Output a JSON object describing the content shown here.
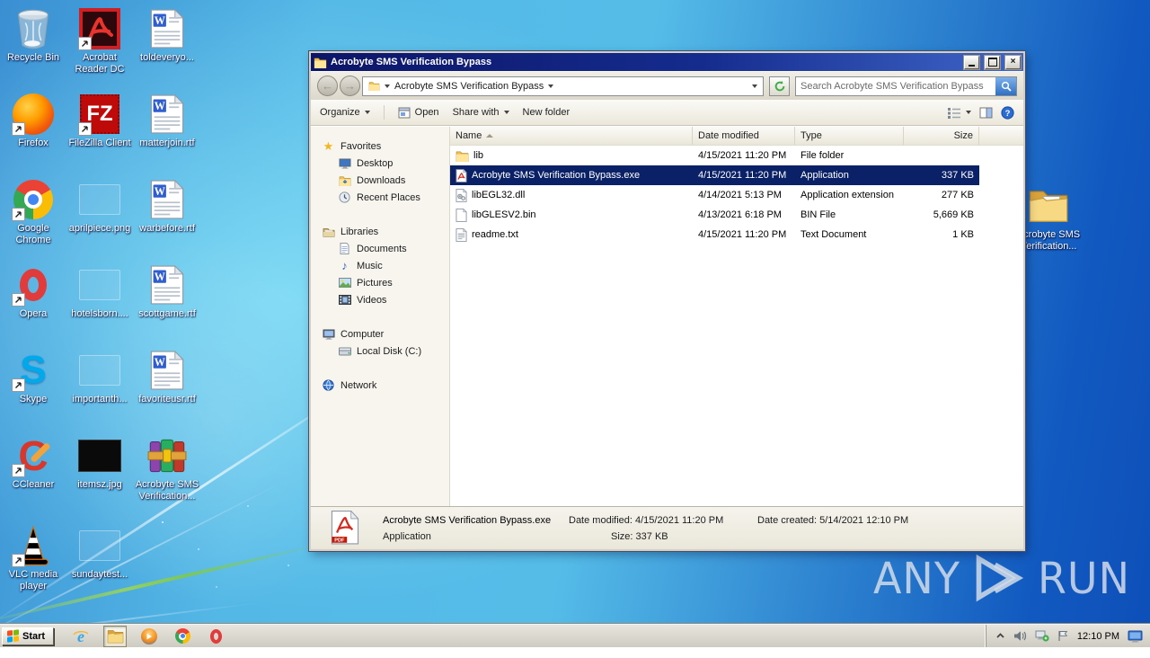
{
  "desktop": {
    "icons": [
      {
        "label": "Recycle Bin",
        "icon": "recycle-bin-icon"
      },
      {
        "label": "Acrobat Reader DC",
        "icon": "acrobat-reader-icon"
      },
      {
        "label": "toldeveryo...",
        "icon": "word-document-icon"
      },
      {
        "label": "Firefox",
        "icon": "firefox-icon"
      },
      {
        "label": "FileZilla Client",
        "icon": "filezilla-icon"
      },
      {
        "label": "matterjoin.rtf",
        "icon": "word-document-icon"
      },
      {
        "label": "Google Chrome",
        "icon": "chrome-icon"
      },
      {
        "label": "aprilpiece.png",
        "icon": "broken-image-icon"
      },
      {
        "label": "warbefore.rtf",
        "icon": "word-document-icon"
      },
      {
        "label": "Opera",
        "icon": "opera-icon"
      },
      {
        "label": "hotelsborn....",
        "icon": "broken-image-icon"
      },
      {
        "label": "scottgame.rtf",
        "icon": "word-document-icon"
      },
      {
        "label": "Skype",
        "icon": "skype-icon"
      },
      {
        "label": "importanth...",
        "icon": "broken-image-icon"
      },
      {
        "label": "favoriteusr.rtf",
        "icon": "word-document-icon"
      },
      {
        "label": "CCleaner",
        "icon": "ccleaner-icon"
      },
      {
        "label": "itemsz.jpg",
        "icon": "image-thumbnail-icon"
      },
      {
        "label": "Acrobyte SMS Verification...",
        "icon": "winrar-archive-icon"
      },
      {
        "label": "VLC media player",
        "icon": "vlc-icon"
      },
      {
        "label": "sundaytest...",
        "icon": "broken-image-icon"
      },
      {
        "label": "Acrobyte SMS Verification...",
        "icon": "folder-icon"
      }
    ]
  },
  "window": {
    "title": "Acrobyte SMS Verification Bypass",
    "address": {
      "path": "Acrobyte SMS Verification Bypass",
      "search_placeholder": "Search Acrobyte SMS Verification Bypass"
    },
    "toolbar": {
      "organize": "Organize",
      "open": "Open",
      "share_with": "Share with",
      "new_folder": "New folder"
    },
    "nav": {
      "groups": [
        {
          "label": "Favorites",
          "items": [
            {
              "label": "Desktop"
            },
            {
              "label": "Downloads"
            },
            {
              "label": "Recent Places"
            }
          ]
        },
        {
          "label": "Libraries",
          "items": [
            {
              "label": "Documents"
            },
            {
              "label": "Music"
            },
            {
              "label": "Pictures"
            },
            {
              "label": "Videos"
            }
          ]
        },
        {
          "label": "Computer",
          "items": [
            {
              "label": "Local Disk (C:)"
            }
          ]
        },
        {
          "label": "Network",
          "items": []
        }
      ]
    },
    "columns": {
      "name": "Name",
      "date": "Date modified",
      "type": "Type",
      "size": "Size"
    },
    "files": [
      {
        "name": "lib",
        "date": "4/15/2021 11:20 PM",
        "type": "File folder",
        "size": "",
        "icon": "folder-icon",
        "selected": false
      },
      {
        "name": "Acrobyte SMS Verification Bypass.exe",
        "date": "4/15/2021 11:20 PM",
        "type": "Application",
        "size": "337 KB",
        "icon": "pdf-application-icon",
        "selected": true
      },
      {
        "name": "libEGL32.dll",
        "date": "4/14/2021 5:13 PM",
        "type": "Application extension",
        "size": "277 KB",
        "icon": "dll-icon",
        "selected": false
      },
      {
        "name": "libGLESV2.bin",
        "date": "4/13/2021 6:18 PM",
        "type": "BIN File",
        "size": "5,669 KB",
        "icon": "bin-file-icon",
        "selected": false
      },
      {
        "name": "readme.txt",
        "date": "4/15/2021 11:20 PM",
        "type": "Text Document",
        "size": "1 KB",
        "icon": "text-file-icon",
        "selected": false
      }
    ],
    "details": {
      "file_name": "Acrobyte SMS Verification Bypass.exe",
      "file_type": "Application",
      "date_modified_label": "Date modified:",
      "date_modified": "4/15/2021 11:20 PM",
      "size_label": "Size:",
      "size": "337 KB",
      "date_created_label": "Date created:",
      "date_created": "5/14/2021 12:10 PM"
    }
  },
  "taskbar": {
    "start_label": "Start",
    "clock": "12:10 PM"
  },
  "watermark": {
    "brand_left": "ANY",
    "brand_right": "RUN"
  },
  "colors": {
    "selection": "#0a2167",
    "titlebar_start": "#0c1568",
    "titlebar_end": "#3f66c8",
    "desktop_light": "#68ccee",
    "desktop_deep": "#1157c8",
    "taskbar": "#d6d2c9"
  }
}
